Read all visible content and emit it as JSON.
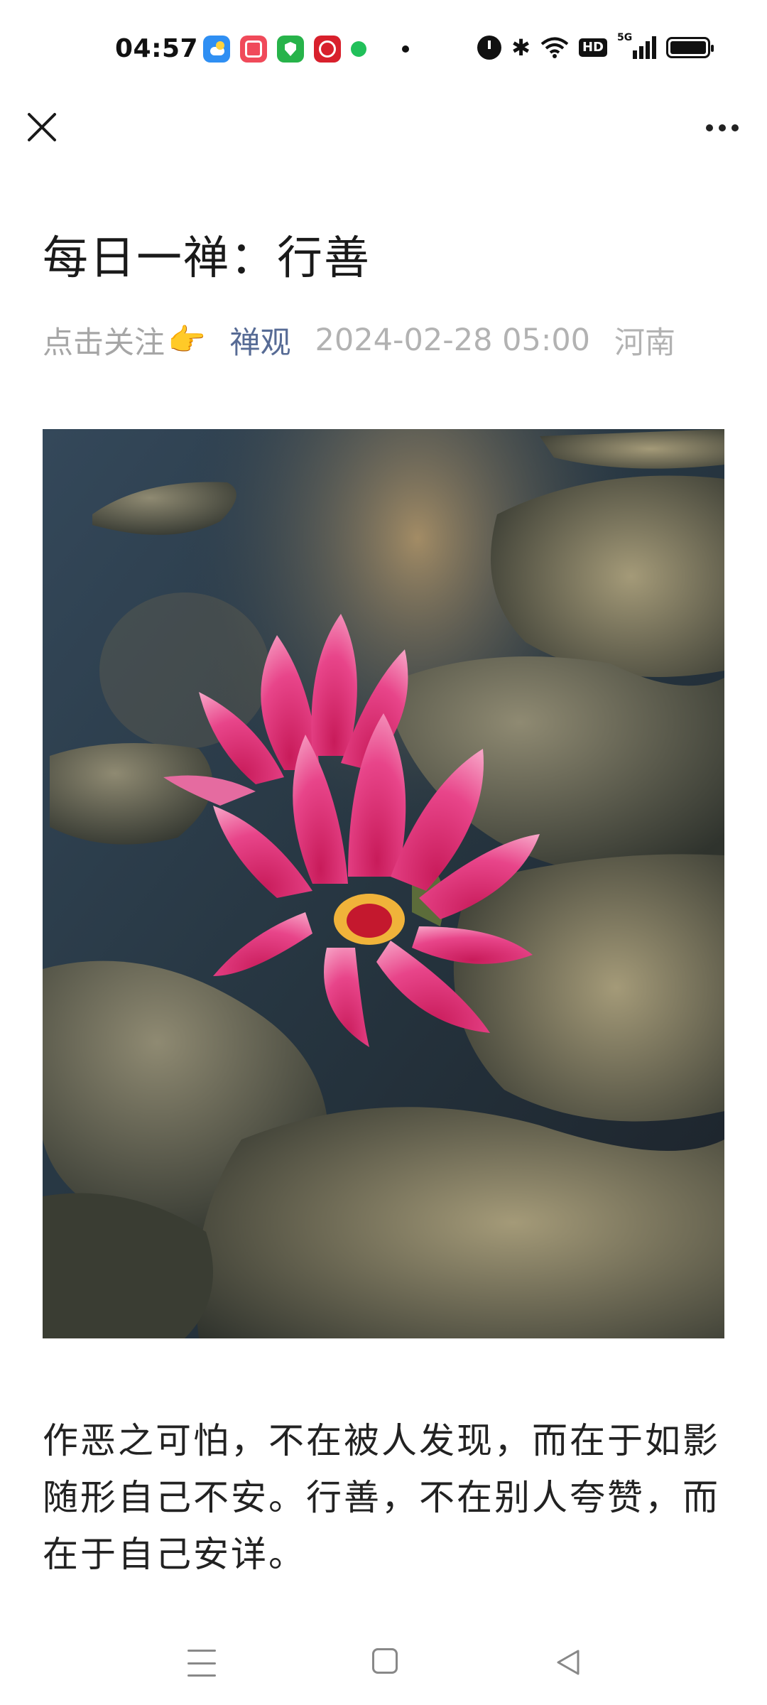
{
  "status_bar": {
    "time": "04:57",
    "notification_icons": [
      "weather-icon",
      "app-icon",
      "security-icon",
      "reward-icon",
      "chat-icon"
    ],
    "system_icons": [
      "alarm-icon",
      "bluetooth-icon",
      "wifi-icon",
      "hd-icon",
      "signal-icon",
      "battery-icon"
    ],
    "hd_label": "HD",
    "network_label": "5G"
  },
  "nav": {
    "close_icon": "close-icon",
    "more_icon": "more-icon"
  },
  "article": {
    "title": "每日一禅：行善",
    "follow_text": "点击关注",
    "hand_emoji": "👉",
    "author": "禅观",
    "date": "2024-02-28 05:00",
    "location": "河南",
    "image": "pink-water-lily-photo",
    "body": "作恶之可怕，不在被人发现，而在于如影随形自己不安。行善，不在别人夸赞，而在于自己安详。"
  },
  "system_nav": {
    "icons": [
      "menu-icon",
      "home-icon",
      "back-icon"
    ]
  }
}
